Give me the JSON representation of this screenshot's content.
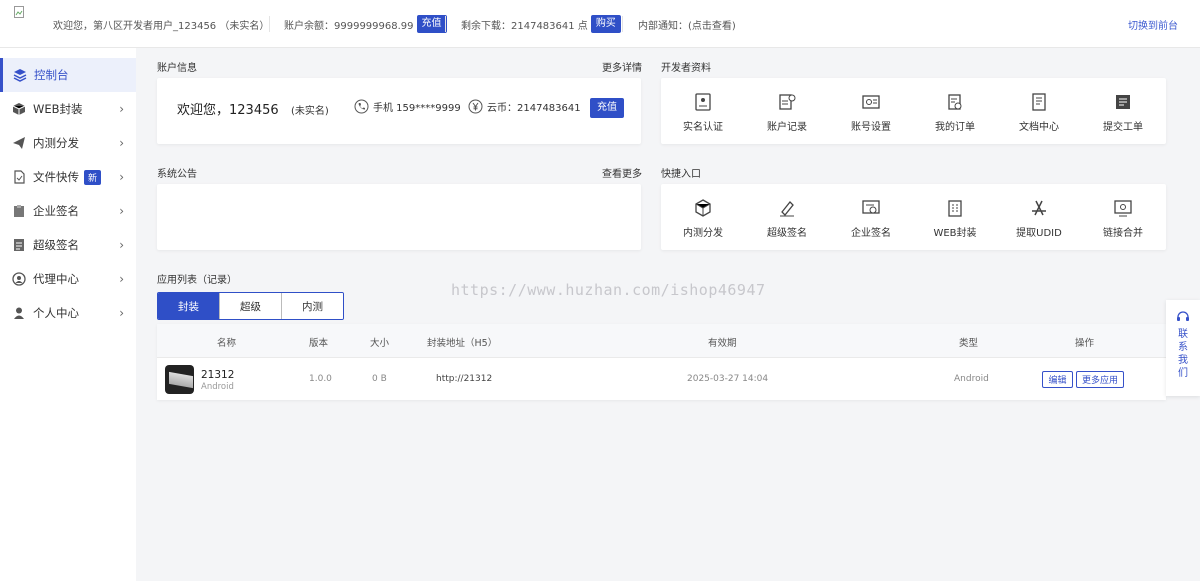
{
  "topbar": {
    "welcome": "欢迎您，第八区开发者用户_123456 （未实名）",
    "balance_label": "账户余额：9999999968.99",
    "recharge_label": "充值",
    "downloads_label": "剩余下载：2147483641 点",
    "buy_label": "购买",
    "notice_label": "内部通知：(点击查看)",
    "switch_label": "切换到前台"
  },
  "sidebar": {
    "items": [
      {
        "label": "控制台",
        "icon": "layers-icon"
      },
      {
        "label": "WEB封装",
        "icon": "box-icon"
      },
      {
        "label": "内测分发",
        "icon": "send-icon"
      },
      {
        "label": "文件快传",
        "icon": "file-icon",
        "badge": "新"
      },
      {
        "label": "企业签名",
        "icon": "clipboard-icon"
      },
      {
        "label": "超级签名",
        "icon": "doc-icon"
      },
      {
        "label": "代理中心",
        "icon": "user-circle-icon"
      },
      {
        "label": "个人中心",
        "icon": "user-icon"
      }
    ]
  },
  "account": {
    "section_title": "账户信息",
    "more": "更多详情",
    "greeting": "欢迎您，123456",
    "status": "(未实名)",
    "phone": "手机 159****9999",
    "coins": "云币：2147483641",
    "recharge_label": "充值"
  },
  "dev": {
    "section_title": "开发者资料",
    "items": [
      "实名认证",
      "账户记录",
      "账号设置",
      "我的订单",
      "文档中心",
      "提交工单"
    ]
  },
  "notice": {
    "section_title": "系统公告",
    "more": "查看更多"
  },
  "quick": {
    "section_title": "快捷入口",
    "items": [
      "内测分发",
      "超级签名",
      "企业签名",
      "WEB封装",
      "提取UDID",
      "链接合并"
    ]
  },
  "apps": {
    "section_title": "应用列表（记录）",
    "tabs": [
      "封装",
      "超级",
      "内测"
    ],
    "columns": [
      "名称",
      "版本",
      "大小",
      "封装地址（H5）",
      "有效期",
      "类型",
      "操作"
    ],
    "rows": [
      {
        "name": "21312",
        "platform": "Android",
        "version": "1.0.0",
        "size": "0 B",
        "url": "http://21312",
        "expiry": "2025-03-27 14:04",
        "type": "Android",
        "edit_label": "编辑",
        "update_label": "更多应用"
      }
    ]
  },
  "watermark": "https://www.huzhan.com/ishop46947",
  "contact": {
    "label": "联系我们"
  },
  "colors": {
    "accent": "#2f4fc7",
    "background": "#f4f5f7"
  }
}
